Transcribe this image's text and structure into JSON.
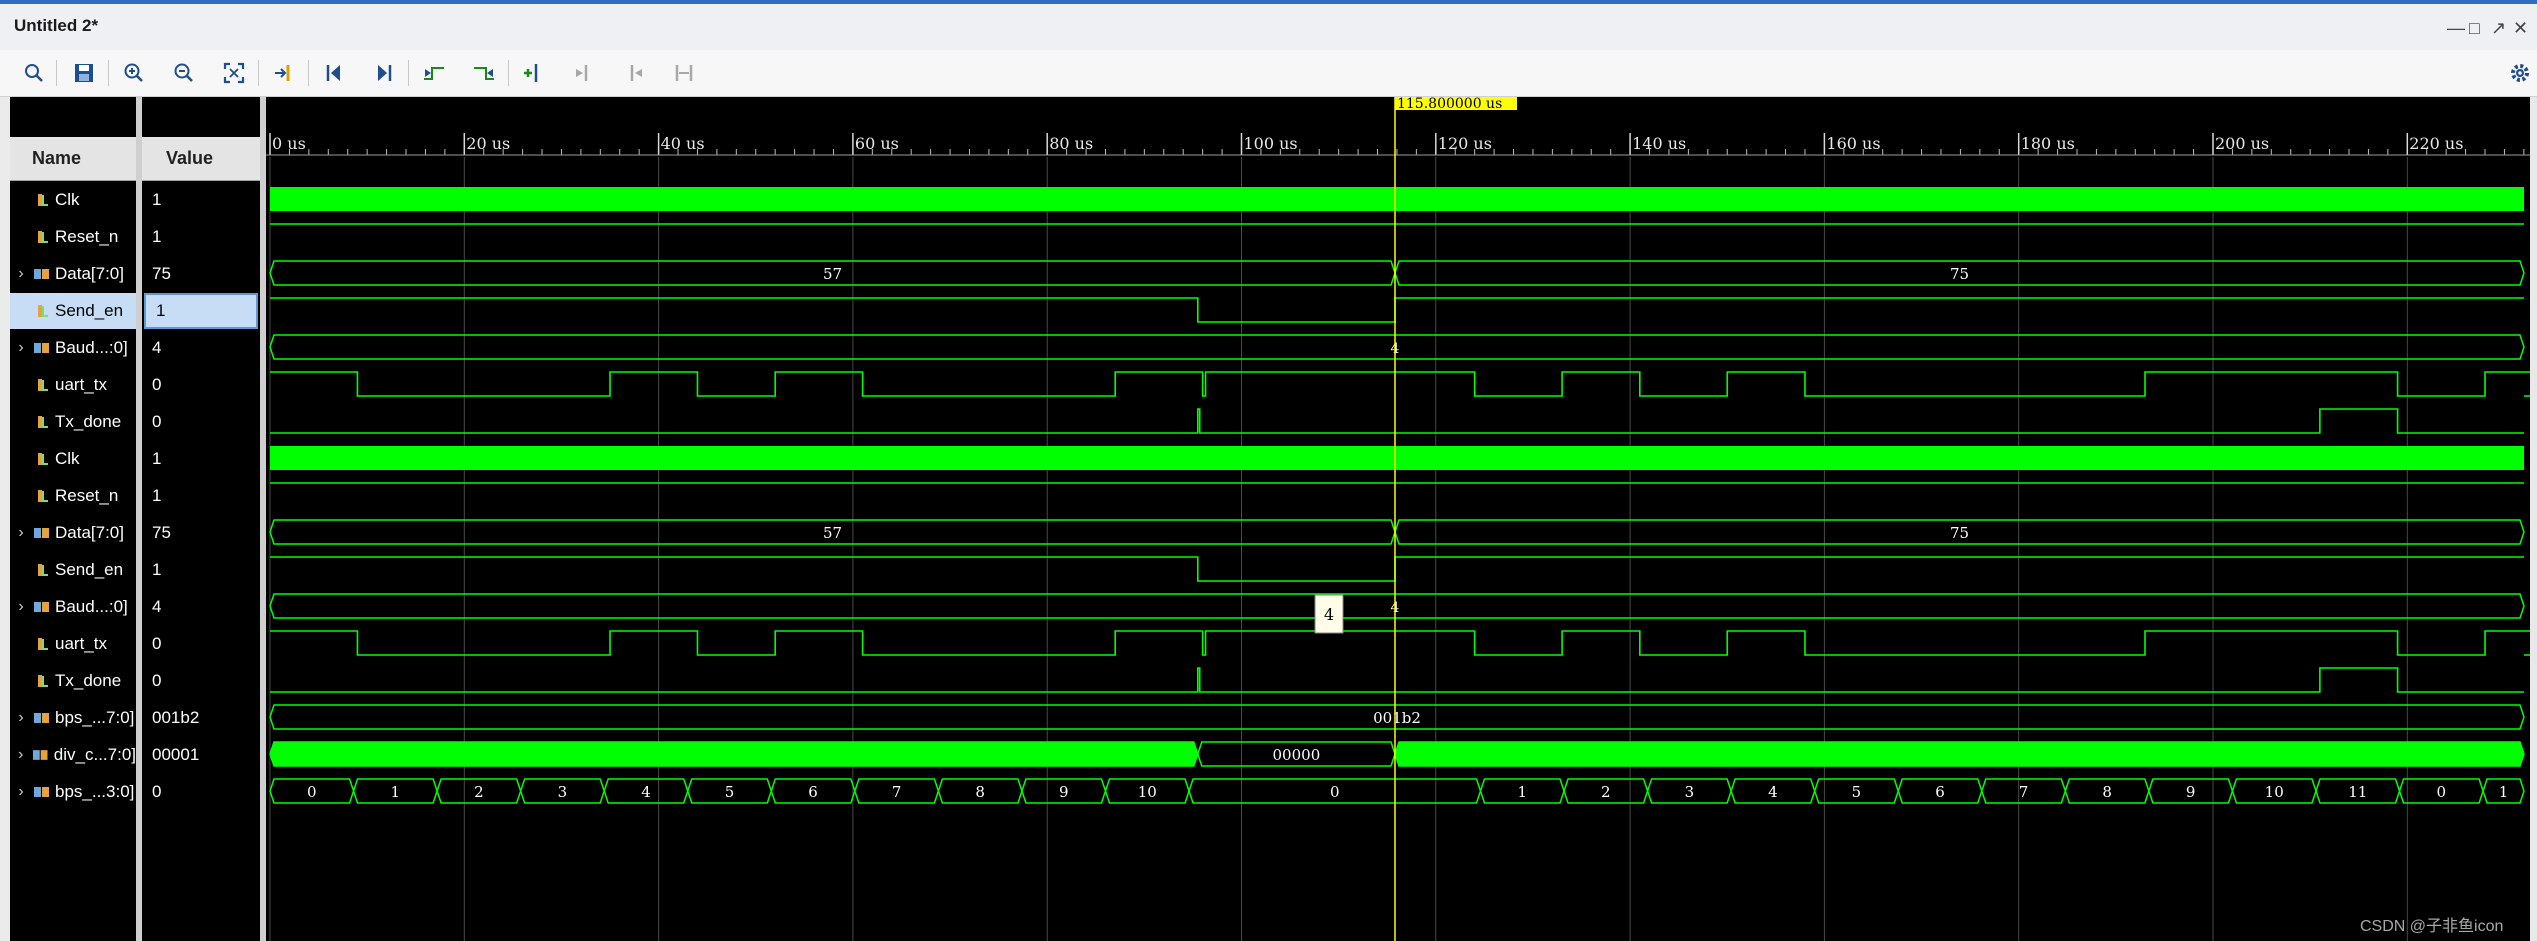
{
  "window": {
    "title": "Untitled 2*",
    "controls": [
      "minimize-icon",
      "restore-icon",
      "popout-icon",
      "close-icon"
    ]
  },
  "toolbar": {
    "icons": [
      "search-icon",
      "save-icon",
      "zoom-in-icon",
      "zoom-out-icon",
      "zoom-fit-icon",
      "go-to-cursor-icon",
      "go-to-time-zero-icon",
      "go-to-last-time-icon",
      "previous-transition-icon",
      "next-transition-icon",
      "add-marker-icon",
      "previous-marker-icon",
      "next-marker-icon",
      "swap-cursors-icon"
    ],
    "settings_icon": "gear-icon"
  },
  "columns": {
    "name": "Name",
    "value": "Value"
  },
  "cursor": {
    "time_label": "115.800000 us",
    "time_us": 115.8
  },
  "time_axis": {
    "ticks": [
      "0 us",
      "20 us",
      "40 us",
      "60 us",
      "80 us",
      "100 us",
      "120 us",
      "140 us",
      "160 us",
      "180 us",
      "200 us",
      "220 us"
    ]
  },
  "signals": [
    {
      "name": "Clk",
      "value": "1",
      "kind": "bit",
      "expandable": false
    },
    {
      "name": "Reset_n",
      "value": "1",
      "kind": "bit",
      "expandable": false
    },
    {
      "name": "Data[7:0]",
      "value": "75",
      "kind": "bus",
      "expandable": true
    },
    {
      "name": "Send_en",
      "value": "1",
      "kind": "bit",
      "expandable": false,
      "selected": true
    },
    {
      "name": "Baud...:0]",
      "value": "4",
      "kind": "bus",
      "expandable": true
    },
    {
      "name": "uart_tx",
      "value": "0",
      "kind": "bit",
      "expandable": false
    },
    {
      "name": "Tx_done",
      "value": "0",
      "kind": "bit",
      "expandable": false
    },
    {
      "name": "Clk",
      "value": "1",
      "kind": "bit",
      "expandable": false
    },
    {
      "name": "Reset_n",
      "value": "1",
      "kind": "bit",
      "expandable": false
    },
    {
      "name": "Data[7:0]",
      "value": "75",
      "kind": "bus",
      "expandable": true
    },
    {
      "name": "Send_en",
      "value": "1",
      "kind": "bit",
      "expandable": false
    },
    {
      "name": "Baud...:0]",
      "value": "4",
      "kind": "bus",
      "expandable": true
    },
    {
      "name": "uart_tx",
      "value": "0",
      "kind": "bit",
      "expandable": false
    },
    {
      "name": "Tx_done",
      "value": "0",
      "kind": "bit",
      "expandable": false
    },
    {
      "name": "bps_...7:0]",
      "value": "001b2",
      "kind": "bus",
      "expandable": true
    },
    {
      "name": "div_c...7:0]",
      "value": "00001",
      "kind": "bus",
      "expandable": true
    },
    {
      "name": "bps_...3:0]",
      "value": "0",
      "kind": "bus",
      "expandable": true
    }
  ],
  "waveform_labels": {
    "data_before": "57",
    "data_after": "75",
    "baud": "4",
    "baud_tooltip": "4",
    "bps_clk": "001b2",
    "div_cnt_idle": "00000",
    "bps_cnt": [
      "0",
      "1",
      "2",
      "3",
      "4",
      "5",
      "6",
      "7",
      "8",
      "9",
      "10",
      "0",
      "1",
      "2",
      "3",
      "4",
      "5",
      "6",
      "7",
      "8",
      "9",
      "10",
      "11",
      "0",
      "1"
    ]
  },
  "watermark": "CSDN @子非鱼icon",
  "colors": {
    "wave": "#00ff00",
    "wave_text": "#ffffff",
    "cursor": "#ffff00",
    "cursor_label_bg": "#ffff00",
    "grid": "#4a4a4a",
    "background": "#000000"
  }
}
